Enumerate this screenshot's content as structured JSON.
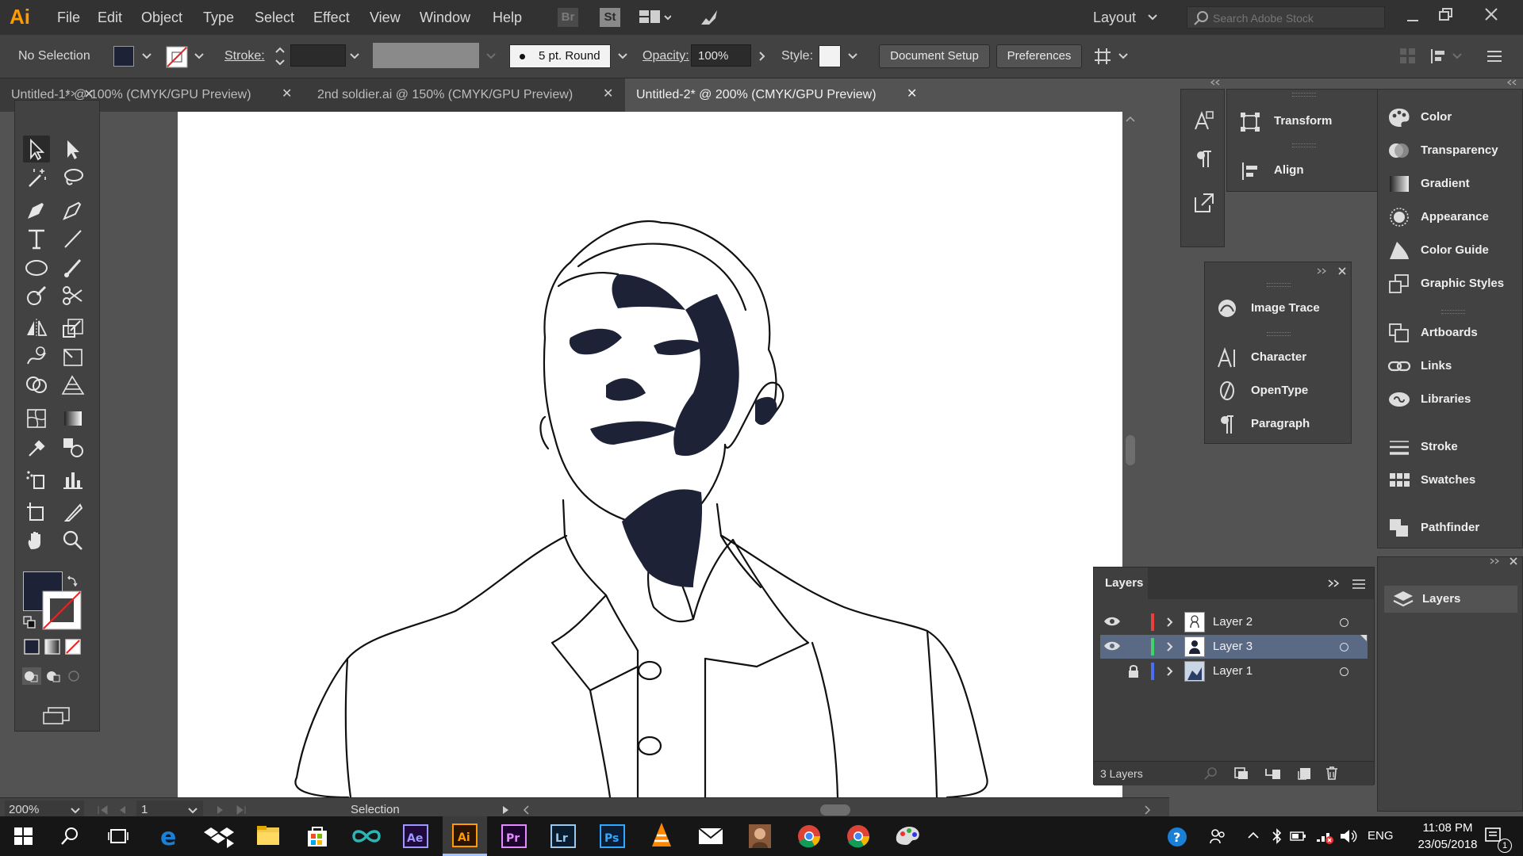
{
  "app": {
    "logo": "Ai",
    "brand_color": "#ff9a00"
  },
  "menu": {
    "items": [
      "File",
      "Edit",
      "Object",
      "Type",
      "Select",
      "Effect",
      "View",
      "Window",
      "Help"
    ],
    "bridge": "Br",
    "stock": "St",
    "workspace": "Layout",
    "search_placeholder": "Search Adobe Stock"
  },
  "control": {
    "selection_state": "No Selection",
    "stroke_label": "Stroke:",
    "brush": "5 pt. Round",
    "opacity_label": "Opacity:",
    "opacity_value": "100%",
    "style_label": "Style:",
    "document_setup": "Document Setup",
    "preferences": "Preferences"
  },
  "tabs": [
    {
      "label": "Untitled-1* @ 100% (CMYK/GPU Preview)",
      "active": false
    },
    {
      "label": "2nd soldier.ai @ 150% (CMYK/GPU Preview)",
      "active": false
    },
    {
      "label": "Untitled-2* @ 200% (CMYK/GPU Preview)",
      "active": true
    }
  ],
  "tools": {
    "fill_color": "#1e2236",
    "stroke_color": "#ffffff"
  },
  "panels": {
    "mid": [
      "Transform",
      "Align"
    ],
    "float": [
      "Image Trace",
      "Character",
      "OpenType",
      "Paragraph"
    ],
    "right": [
      "Color",
      "Transparency",
      "Gradient",
      "Appearance",
      "Color Guide",
      "Graphic Styles",
      "Artboards",
      "Links",
      "Libraries",
      "Stroke",
      "Swatches",
      "Pathfinder"
    ],
    "right_bottom": "Layers"
  },
  "layers": {
    "title": "Layers",
    "count": "3 Layers",
    "rows": [
      {
        "name": "Layer 2",
        "color": "#e8413b",
        "visible": true,
        "locked": false,
        "selected": false
      },
      {
        "name": "Layer 3",
        "color": "#3fd36a",
        "visible": true,
        "locked": false,
        "selected": true
      },
      {
        "name": "Layer 1",
        "color": "#4b6ef2",
        "visible": false,
        "locked": true,
        "selected": false
      }
    ]
  },
  "status": {
    "zoom": "200%",
    "page": "1",
    "tool": "Selection"
  },
  "artwork": {
    "fill": "#1e2236"
  },
  "taskbar": {
    "apps": [
      "edge",
      "dropbox",
      "explorer",
      "store",
      "arduino",
      "after-effects",
      "illustrator",
      "premiere",
      "lightroom",
      "photoshop",
      "vlc",
      "mail",
      "user",
      "chrome",
      "chrome-2",
      "paint"
    ],
    "app_labels": {
      "ae": "Ae",
      "ai": "Ai",
      "pr": "Pr",
      "lr": "Lr",
      "ps": "Ps"
    },
    "language": "ENG",
    "time": "11:08 PM",
    "date": "23/05/2018",
    "notifications": "1"
  }
}
